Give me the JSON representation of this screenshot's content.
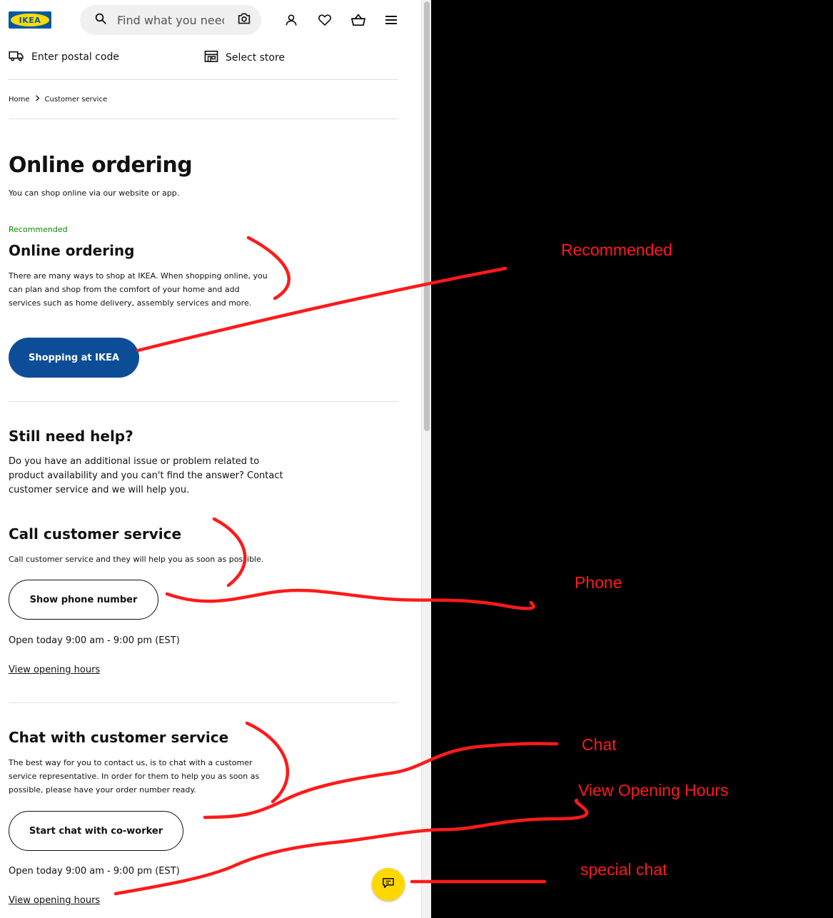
{
  "header": {
    "logo_text": "IKEA",
    "search_placeholder": "Find what you need",
    "icons": [
      "search-icon",
      "camera-icon",
      "account-icon",
      "heart-icon",
      "basket-icon",
      "menu-icon"
    ]
  },
  "location": {
    "postal_label": "Enter postal code",
    "store_label": "Select store"
  },
  "breadcrumb": {
    "home": "Home",
    "current": "Customer service"
  },
  "main": {
    "title": "Online ordering",
    "subtitle": "You can shop online via our website or app.",
    "recommended": {
      "badge": "Recommended",
      "heading": "Online ordering",
      "text": "There are many ways to shop at IKEA. When shopping online, you can plan and shop from the comfort of your home and add services such as home delivery, assembly services and more.",
      "button": "Shopping at IKEA"
    },
    "help": {
      "heading": "Still need help?",
      "text": "Do you have an additional issue or problem related to product availability and you can't find the answer? Contact customer service and we will help you."
    },
    "call": {
      "heading": "Call customer service",
      "text": "Call customer service and they will help you as soon as possible.",
      "button": "Show phone number",
      "hours": "Open today 9:00 am - 9:00 pm (EST)",
      "link": "View opening hours"
    },
    "chat": {
      "heading": "Chat with customer service",
      "text": "The best way for you to contact us, is to chat with a customer service representative. In order for them to help you as soon as possible, please have your order number ready.",
      "button": "Start chat with co-worker",
      "hours": "Open today 9:00 am - 9:00 pm (EST)",
      "link": "View opening hours"
    }
  },
  "annotations": {
    "recommended": "Recommended",
    "phone": "Phone",
    "chat": "Chat",
    "hours": "View Opening Hours",
    "special": "special chat",
    "color": "#ff1a1a"
  },
  "colors": {
    "brand_blue": "#0d4d97",
    "logo_yellow": "#ffdb00",
    "recommended_green": "#0a8a00",
    "fab_yellow": "#ffd800"
  }
}
